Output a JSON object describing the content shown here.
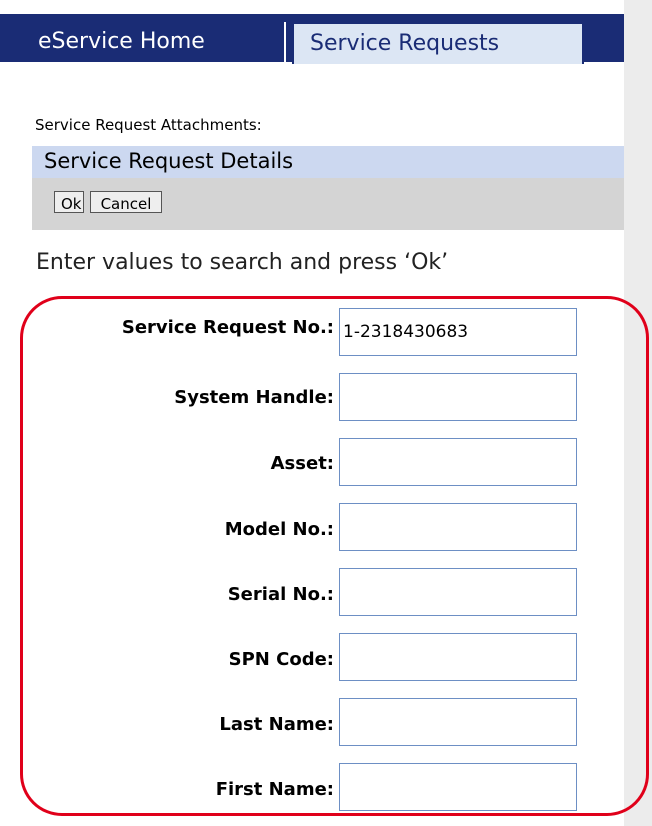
{
  "tabs": {
    "home_label": "eService Home",
    "service_requests_label": "Service Requests"
  },
  "attachments_label": "Service Request Attachments:",
  "details": {
    "title": "Service Request Details",
    "ok_label": "Ok",
    "cancel_label": "Cancel"
  },
  "instruction": "Enter values to search and press ‘Ok’",
  "form": {
    "fields": [
      {
        "label": "Service Request No.:",
        "value": "1-2318430683"
      },
      {
        "label": "System Handle:",
        "value": ""
      },
      {
        "label": "Asset:",
        "value": ""
      },
      {
        "label": "Model No.:",
        "value": ""
      },
      {
        "label": "Serial No.:",
        "value": ""
      },
      {
        "label": "SPN Code:",
        "value": ""
      },
      {
        "label": "Last Name:",
        "value": ""
      },
      {
        "label": "First Name:",
        "value": ""
      }
    ]
  },
  "colors": {
    "tab_bar": "#1a2c75",
    "active_tab": "#dce6f4",
    "details_header": "#ccd8f0",
    "highlight_frame": "#e0001a"
  }
}
